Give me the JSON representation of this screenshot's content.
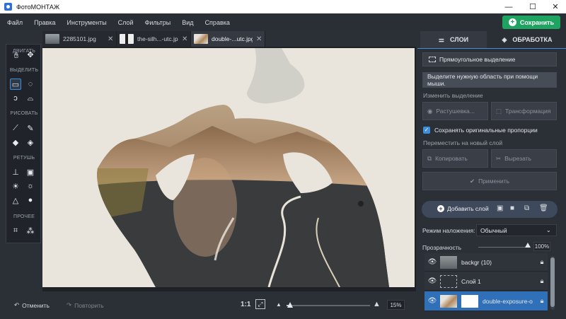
{
  "app": {
    "title": "ФотоМОНТАЖ"
  },
  "window": {
    "minimize": "—",
    "maximize": "☐",
    "close": "✕"
  },
  "menu": [
    "Файл",
    "Правка",
    "Инструменты",
    "Слой",
    "Фильтры",
    "Вид",
    "Справка"
  ],
  "save_button": "Сохранить",
  "tools": {
    "move_label": "ДВИГАТЬ",
    "select_label": "ВЫДЕЛИТЬ",
    "draw_label": "РИСОВАТЬ",
    "retouch_label": "РЕТУШЬ",
    "other_label": "ПРОЧЕЕ"
  },
  "tabs": [
    {
      "name": "2285101.jpg",
      "close": "✕"
    },
    {
      "name": "the-silh...-utc.jpg",
      "close": "✕"
    },
    {
      "name": "double-...utc.jpg",
      "close": "✕"
    }
  ],
  "bottom": {
    "undo": "Отменить",
    "redo": "Повторить",
    "ratio": "1:1",
    "zoom": "15%",
    "zoom_fraction": 0.04
  },
  "panel": {
    "tab_layers": "СЛОИ",
    "tab_processing": "ОБРАБОТКА",
    "rect_select": "Прямоугольное выделение",
    "hint": "Выделите нужную область при помощи мыши.",
    "change_selection": "Изменить выделение",
    "feather": "Растушевка...",
    "transform": "Трансформация",
    "keep_proportions": "Сохранять оригинальные пропорции",
    "move_to_layer": "Переместить на новый слой",
    "copy": "Копировать",
    "cut": "Вырезать",
    "apply": "Применить",
    "add_layer": "Добавить слой",
    "blend_mode_label": "Режим наложения:",
    "blend_mode_value": "Обычный",
    "opacity_label": "Прозрачность",
    "opacity_value": "100%",
    "opacity_fraction": 1.0
  },
  "layers": [
    {
      "name": "backgr (10)",
      "lock": "🔒︎"
    },
    {
      "name": "Слой 1",
      "lock": "🔒︎"
    },
    {
      "name": "double-exposure-o",
      "lock": "🔒︎"
    }
  ],
  "colors": {
    "accent": "#3e8ede",
    "save": "#1ea361",
    "active_layer": "#2f70b8"
  }
}
